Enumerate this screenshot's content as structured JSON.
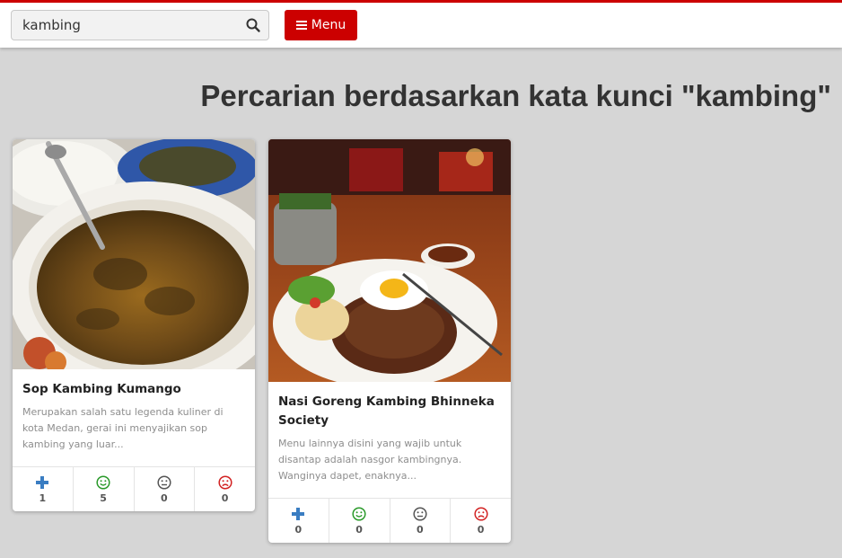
{
  "search": {
    "value": "kambing",
    "placeholder": ""
  },
  "header": {
    "menu_label": "Menu"
  },
  "page_title": "Percarian berdasarkan kata kunci \"kambing\"",
  "colors": {
    "brand": "#cc0000",
    "add": "#3a7dc2",
    "happy": "#2a9a2a",
    "neutral": "#555555",
    "sad": "#d22222"
  },
  "results": [
    {
      "title": "Sop Kambing Kumango",
      "description": "Merupakan salah satu legenda kuliner di kota Medan, gerai ini menyajikan sop kambing yang luar...",
      "stats": {
        "add": "1",
        "happy": "5",
        "neutral": "0",
        "sad": "0"
      }
    },
    {
      "title": "Nasi Goreng Kambing Bhinneka Society",
      "description": "Menu lainnya disini yang wajib untuk disantap adalah nasgor kambingnya. Wanginya dapet, enaknya...",
      "stats": {
        "add": "0",
        "happy": "0",
        "neutral": "0",
        "sad": "0"
      }
    }
  ]
}
